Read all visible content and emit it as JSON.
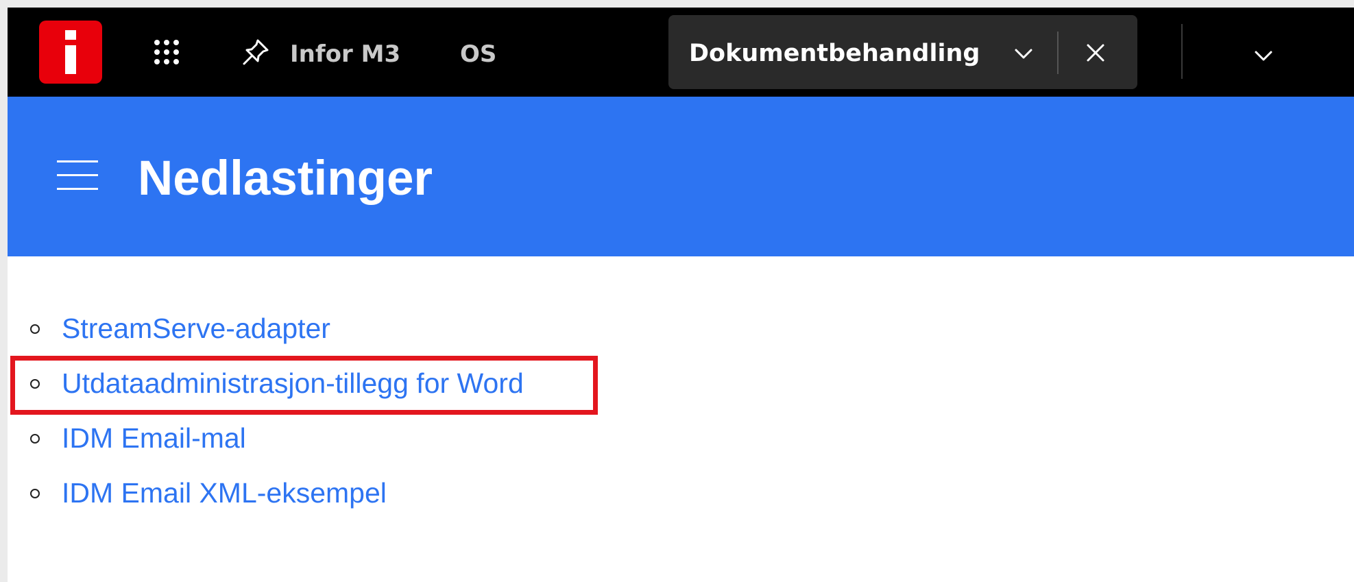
{
  "topbar": {
    "logo_icon": "infor-logo-icon",
    "apps_icon": "apps-grid-icon",
    "pin_icon": "pin-icon",
    "app_name": "Infor M3",
    "tenant": "OS",
    "active_tab": {
      "title": "Dokumentbehandling",
      "chevron_icon": "chevron-down-icon",
      "close_icon": "close-icon"
    },
    "user_menu_icon": "chevron-down-icon"
  },
  "header": {
    "menu_icon": "hamburger-menu-icon",
    "title": "Nedlastinger"
  },
  "downloads": [
    {
      "label": "StreamServe-adapter"
    },
    {
      "label": "Utdataadministrasjon-tillegg for Word",
      "highlighted": true
    },
    {
      "label": "IDM Email-mal"
    },
    {
      "label": "IDM Email XML-eksempel"
    }
  ],
  "colors": {
    "topbar_bg": "#000000",
    "header_bg": "#2d74f2",
    "link": "#2d74f2",
    "logo_bg": "#e8000b",
    "highlight": "#e3161e"
  }
}
